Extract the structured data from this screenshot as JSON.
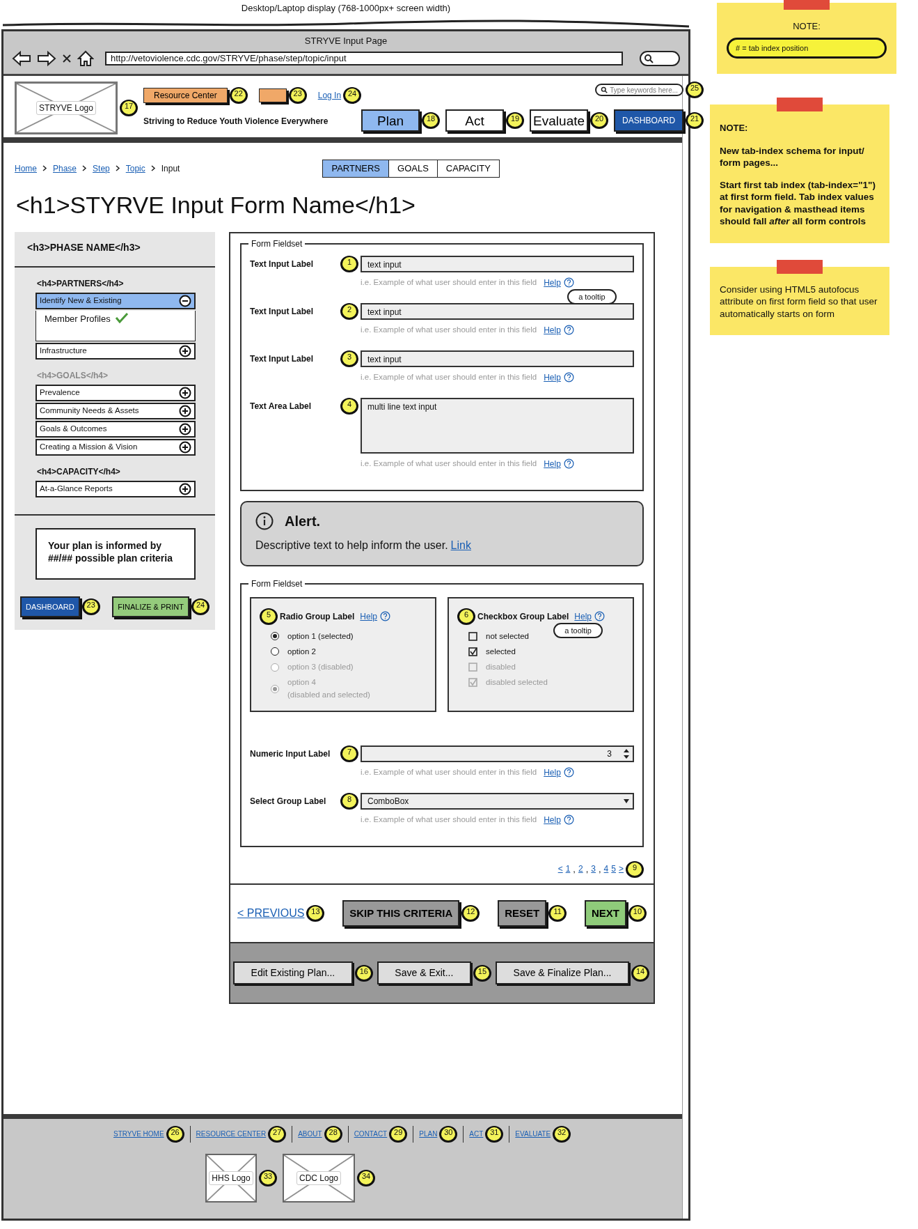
{
  "caption": "Desktop/Laptop display (768-1000px+ screen width)",
  "browser": {
    "title": "STRYVE Input Page",
    "url": "http://vetoviolence.cdc.gov/STRYVE/phase/step/topic/input"
  },
  "masthead": {
    "logo": {
      "label": "STRYVE Logo",
      "tab_index": "17"
    },
    "links": [
      {
        "kind": "button",
        "label": "Resource Center",
        "tab_index": "22"
      },
      {
        "kind": "button",
        "tab_index": "23"
      },
      {
        "kind": "link",
        "label": "Log In",
        "tab_index": "24"
      }
    ],
    "tagline": "Striving to Reduce Youth Violence Everywhere",
    "search": {
      "placeholder": "Type keywords here...",
      "tab_index": "25"
    }
  },
  "main_tabs": [
    {
      "kind": "tab",
      "label": "Plan",
      "selected": true,
      "tab_index": "18"
    },
    {
      "kind": "tab",
      "label": "Act",
      "selected": false,
      "tab_index": "19"
    },
    {
      "kind": "tab",
      "label": "Evaluate",
      "selected": false,
      "tab_index": "20"
    },
    {
      "kind": "dashboard",
      "label": "DASHBOARD",
      "selected": false,
      "tab_index": "21"
    }
  ],
  "sub_tabs": [
    {
      "label": "PARTNERS",
      "selected": true
    },
    {
      "label": "GOALS",
      "selected": false
    },
    {
      "label": "CAPACITY",
      "selected": false
    }
  ],
  "breadcrumb": [
    {
      "kind": "link",
      "label": "Home"
    },
    {
      "kind": "link",
      "label": "Phase"
    },
    {
      "kind": "link",
      "label": "Step"
    },
    {
      "kind": "link",
      "label": "Topic"
    },
    {
      "kind": "current",
      "label": "Input"
    }
  ],
  "heading": "<h1>STYRVE Input Form Name</h1>",
  "sidebar": {
    "title": "<h3>PHASE NAME</h3>",
    "sections": [
      {
        "heading": "<h4>PARTNERS</h4>",
        "disabled": false,
        "items": [
          {
            "label": "Identify New & Existing",
            "selected": true,
            "expanded": true,
            "children": [
              {
                "label": "Member Profiles",
                "checked": true
              }
            ]
          },
          {
            "label": "Infrastructure",
            "selected": false,
            "expanded": false
          }
        ]
      },
      {
        "heading": "<h4>GOALS</h4>",
        "disabled": true,
        "items": [
          {
            "label": "Prevalence",
            "selected": false,
            "expanded": false
          },
          {
            "label": "Community Needs & Assets",
            "selected": false,
            "expanded": false
          },
          {
            "label": "Goals & Outcomes",
            "selected": false,
            "expanded": false
          },
          {
            "label": "Creating a Mission & Vision",
            "selected": false,
            "expanded": false
          }
        ]
      },
      {
        "heading": "<h4>CAPACITY</h4>",
        "disabled": false,
        "items": [
          {
            "label": "At-a-Glance Reports",
            "selected": false,
            "expanded": false
          }
        ]
      }
    ],
    "summary": "Your plan is informed by ##/## possible plan criteria",
    "buttons": [
      {
        "kind": "dashboard",
        "label": "DASHBOARD",
        "tab_index": "23"
      },
      {
        "kind": "finalize",
        "label": "FINALIZE & PRINT",
        "tab_index": "24"
      }
    ]
  },
  "fieldset_1": {
    "legend": "Form Fieldset",
    "fields": [
      {
        "kind": "text",
        "label": "Text Input Label",
        "value": "text input",
        "hint": "i.e. Example of what user should enter in this field",
        "help": "Help",
        "tooltip": "a tooltip",
        "tab_index": "1"
      },
      {
        "kind": "text",
        "label": "Text Input Label",
        "value": "text input",
        "hint": "i.e. Example of what user should enter in this field",
        "help": "Help",
        "tab_index": "2"
      },
      {
        "kind": "text",
        "label": "Text Input Label",
        "value": "text input",
        "hint": "i.e. Example of what user should enter in this field",
        "help": "Help",
        "tab_index": "3"
      },
      {
        "kind": "textarea",
        "label": "Text Area Label",
        "value": "multi line text input",
        "hint": "i.e. Example of what user should enter in this field",
        "help": "Help",
        "tab_index": "4"
      }
    ]
  },
  "alert": {
    "title": "Alert.",
    "text": "Descriptive text to help inform the user.",
    "link": "Link"
  },
  "fieldset_2": {
    "legend": "Form Fieldset",
    "radio_group": {
      "label": "Radio Group Label",
      "help": "Help",
      "tab_index": "5",
      "options": [
        {
          "label": "option 1 (selected)",
          "selected": true,
          "disabled": false
        },
        {
          "label": "option 2",
          "selected": false,
          "disabled": false
        },
        {
          "label": "option 3 (disabled)",
          "selected": false,
          "disabled": true
        },
        {
          "label": "option 4",
          "note": "(disabled and selected)",
          "selected": true,
          "disabled": true
        }
      ]
    },
    "checkbox_group": {
      "label": "Checkbox Group Label",
      "help": "Help",
      "tooltip": "a tooltip",
      "tab_index": "6",
      "options": [
        {
          "label": "not selected",
          "checked": false,
          "disabled": false
        },
        {
          "label": "selected",
          "checked": true,
          "disabled": false
        },
        {
          "label": "disabled",
          "checked": false,
          "disabled": true
        },
        {
          "label": "disabled selected",
          "checked": true,
          "disabled": true
        }
      ]
    },
    "fields": [
      {
        "kind": "numeric",
        "label": "Numeric Input Label",
        "value": "3",
        "hint": "i.e. Example of what user should enter in this field",
        "help": "Help",
        "tab_index": "7"
      },
      {
        "kind": "select",
        "label": "Select Group Label",
        "value": "ComboBox",
        "hint": "i.e. Example of what user should enter in this field",
        "help": "Help",
        "tab_index": "8"
      }
    ]
  },
  "pagination": {
    "tab_index": "9",
    "items": [
      {
        "label": "<"
      },
      {
        "label": "1",
        "separator": ","
      },
      {
        "label": "2",
        "separator": ","
      },
      {
        "label": "3",
        "separator": ","
      },
      {
        "label": "4"
      },
      {
        "label": "5"
      },
      {
        "label": ">"
      }
    ]
  },
  "actions": [
    {
      "kind": "link",
      "label": "< PREVIOUS",
      "tab_index": "13"
    },
    {
      "kind": "secondary",
      "label": "SKIP THIS CRITERIA",
      "tab_index": "12"
    },
    {
      "kind": "secondary",
      "label": "RESET",
      "tab_index": "11"
    },
    {
      "kind": "primary",
      "label": "NEXT",
      "tab_index": "10"
    }
  ],
  "plan_buttons": [
    {
      "label": "Edit Existing Plan...",
      "tab_index": "16"
    },
    {
      "label": "Save & Exit...",
      "tab_index": "15"
    },
    {
      "label": "Save & Finalize Plan...",
      "tab_index": "14"
    }
  ],
  "footer": {
    "links": [
      {
        "label": "STRYVE HOME",
        "tab_index": "26"
      },
      {
        "label": "RESOURCE CENTER",
        "tab_index": "27"
      },
      {
        "label": "ABOUT",
        "tab_index": "28"
      },
      {
        "label": "CONTACT",
        "tab_index": "29"
      },
      {
        "label": "PLAN",
        "tab_index": "30"
      },
      {
        "label": "ACT",
        "tab_index": "31"
      },
      {
        "label": "EVALUATE",
        "tab_index": "32"
      }
    ],
    "logos": [
      {
        "label": "HHS Logo",
        "tab_index": "33"
      },
      {
        "label": "CDC Logo",
        "tab_index": "34"
      }
    ]
  },
  "notes": [
    {
      "kind": "legend",
      "title": "NOTE:",
      "badge": "# = tab index position"
    },
    {
      "kind": "bold",
      "title": "NOTE:",
      "paragraphs": [
        "New tab-index schema for input/ form pages...",
        "Start first tab index (tab-index=\"1\") at first form field. Tab index values for navigation & masthead items should fall *after* all form controls"
      ]
    },
    {
      "kind": "plain",
      "paragraphs": [
        "Consider using HTML5 autofocus attribute on first form field so that user automatically starts on form"
      ]
    }
  ]
}
